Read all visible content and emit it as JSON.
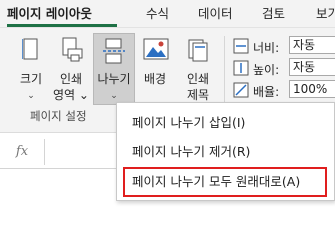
{
  "tabs": [
    {
      "label": "페이지 레이아웃",
      "active": true
    },
    {
      "label": "수식"
    },
    {
      "label": "데이터"
    },
    {
      "label": "검토"
    },
    {
      "label": "보기"
    }
  ],
  "ribbon": {
    "buttons": [
      {
        "line1": "크기"
      },
      {
        "line1": "인쇄",
        "line2": "영역"
      },
      {
        "line1": "나누기",
        "selected": true
      },
      {
        "line1": "배경"
      },
      {
        "line1": "인쇄",
        "line2": "제목"
      }
    ],
    "group_label": "페이지 설정",
    "scale": {
      "width_label": "너비:",
      "width_value": "자동",
      "height_label": "높이:",
      "height_value": "자동",
      "scale_label": "배율:",
      "scale_value": "100%"
    }
  },
  "formula_bar": {
    "fx": "fx"
  },
  "menu": {
    "items": [
      {
        "label": "페이지 나누기 삽입(I)"
      },
      {
        "label": "페이지 나누기 제거(R)"
      },
      {
        "label": "페이지 나누기 모두 원래대로(A)",
        "highlighted": true
      }
    ]
  },
  "colors": {
    "accent": "#1e7145",
    "highlight_border": "#e01e1e"
  },
  "icons": [
    "size-icon",
    "print-area-icon",
    "breaks-icon",
    "background-icon",
    "print-titles-icon",
    "width-icon",
    "height-icon",
    "scale-icon"
  ]
}
